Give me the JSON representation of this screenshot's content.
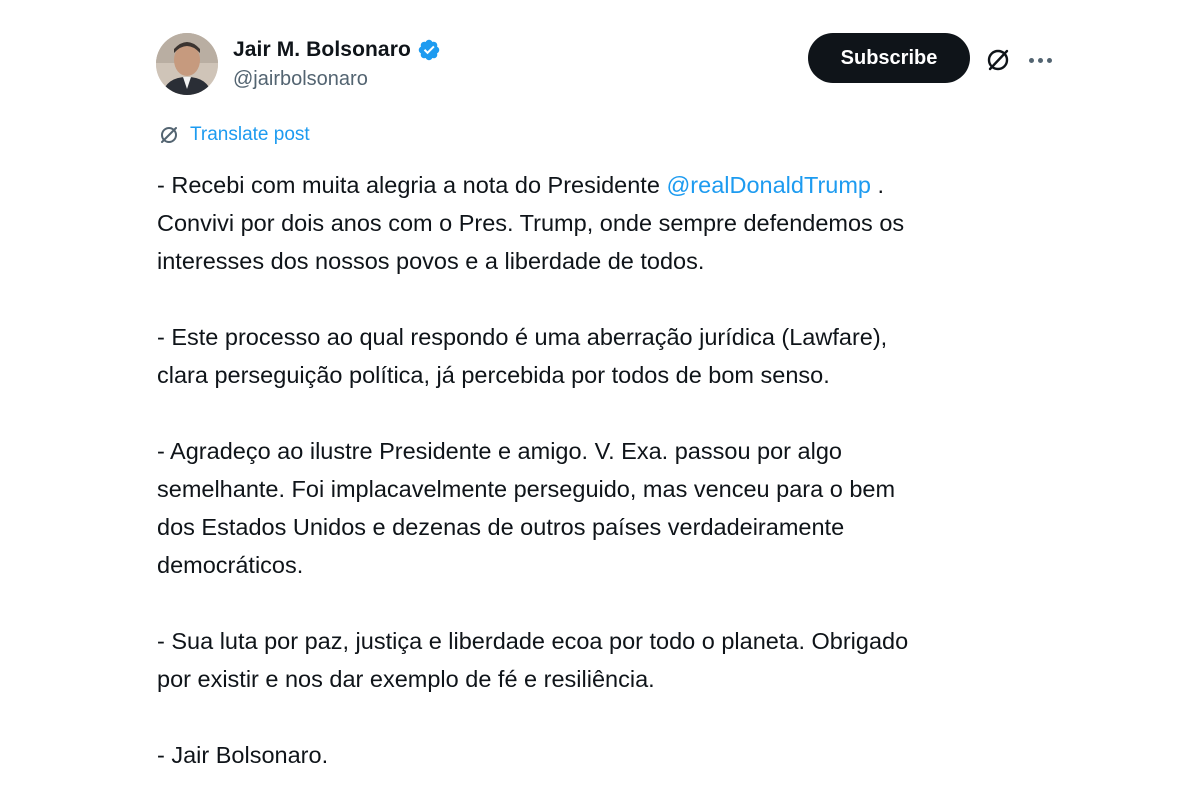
{
  "author": {
    "display_name": "Jair M. Bolsonaro",
    "handle": "@jairbolsonaro",
    "verified": true,
    "verified_color": "#1d9bf0"
  },
  "actions": {
    "subscribe_label": "Subscribe",
    "grok_icon": "grok-icon",
    "more_icon": "more-icon"
  },
  "translate": {
    "label": "Translate post",
    "icon": "translate-icon"
  },
  "post": {
    "p1": {
      "l1_before": "- Recebi com muita alegria a nota do Presidente ",
      "mention": "@realDonaldTrump",
      "l1_after": " .",
      "l2": "Convivi por dois anos com o Pres. Trump, onde sempre defendemos os",
      "l3": "interesses dos nossos povos e a liberdade de todos."
    },
    "p2": {
      "l1": "- Este processo ao qual respondo é uma aberração jurídica (Lawfare),",
      "l2": "clara perseguição política, já percebida por todos de bom senso."
    },
    "p3": {
      "l1": "- Agradeço ao ilustre Presidente e amigo. V. Exa. passou por algo",
      "l2": "semelhante. Foi implacavelmente perseguido, mas venceu para o bem",
      "l3": "dos Estados Unidos e dezenas de outros países verdadeiramente",
      "l4": "democráticos."
    },
    "p4": {
      "l1": "- Sua luta por paz, justiça e liberdade ecoa por todo o planeta. Obrigado",
      "l2": "por existir e nos dar exemplo de fé e resiliência."
    },
    "p5": {
      "l1": "- Jair Bolsonaro."
    }
  },
  "colors": {
    "text": "#0f1419",
    "secondary": "#536471",
    "link": "#1d9bf0",
    "button_bg": "#0f1419"
  }
}
